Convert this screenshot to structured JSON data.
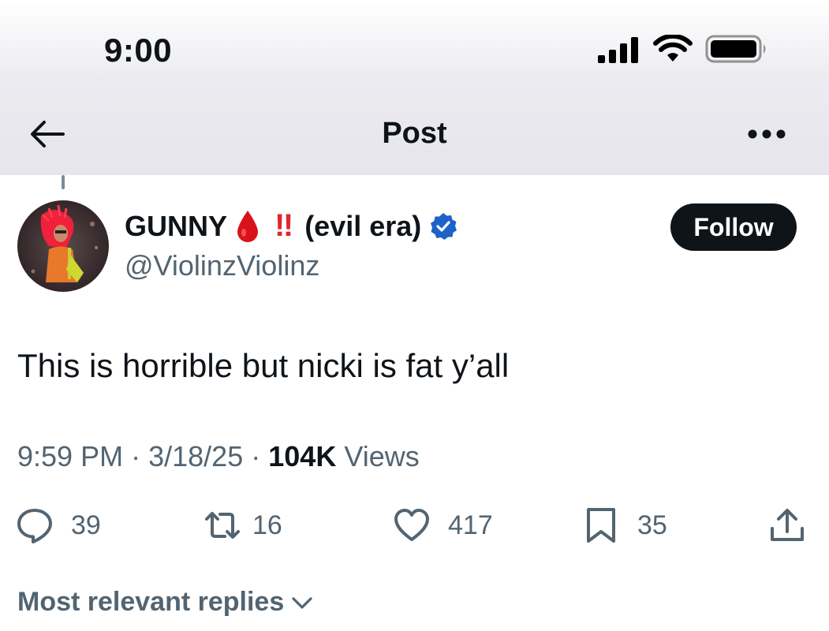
{
  "status_bar": {
    "time": "9:00",
    "icons": [
      "cellular-signal-icon",
      "wifi-icon",
      "battery-icon"
    ]
  },
  "nav": {
    "back_icon": "arrow-left-icon",
    "title": "Post",
    "more_icon": "more-horizontal-icon"
  },
  "post": {
    "author": {
      "name_main": "GUNNY",
      "name_emoji_1": "drop-of-blood-emoji",
      "name_emoji_2": "‼",
      "name_suffix": "(evil era)",
      "verified": true,
      "handle": "@ViolinzViolinz"
    },
    "follow_label": "Follow",
    "text": "This is horrible but nicki is fat y’all",
    "time": "9:59 PM",
    "date": "3/18/25",
    "separator": "·",
    "views_count": "104K",
    "views_label": "Views",
    "stats": {
      "replies": "39",
      "reposts": "16",
      "likes": "417",
      "bookmarks": "35"
    }
  },
  "replies_filter": {
    "label": "Most relevant replies"
  },
  "colors": {
    "text": "#0f1419",
    "secondary": "#536471",
    "verified_blue": "#1d62c9",
    "follow_bg": "#0f1419",
    "emoji_red": "#e0262f"
  }
}
